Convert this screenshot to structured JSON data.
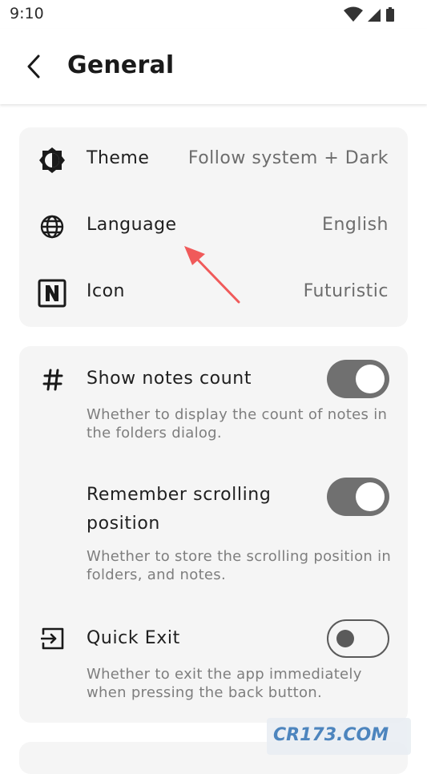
{
  "status": {
    "time": "9:10"
  },
  "header": {
    "title": "General"
  },
  "general_card": {
    "items": [
      {
        "label": "Theme",
        "value": "Follow system + Dark",
        "icon": "theme-icon"
      },
      {
        "label": "Language",
        "value": "English",
        "icon": "globe-icon"
      },
      {
        "label": "Icon",
        "value": "Futuristic",
        "icon": "app-icon-n"
      }
    ]
  },
  "notes_card": {
    "items": [
      {
        "label": "Show notes count",
        "description": "Whether to display the count of notes in the folders dialog.",
        "enabled": true,
        "icon": "hash-icon"
      },
      {
        "label": "Remember scrolling position",
        "description": "Whether to store the scrolling position in folders, and notes.",
        "enabled": true
      },
      {
        "label": "Quick Exit",
        "description": "Whether to exit the app immediately when pressing the back button.",
        "enabled": false,
        "icon": "exit-icon"
      }
    ]
  },
  "watermark": {
    "text": "CR173.COM"
  },
  "colors": {
    "card_bg": "#f5f5f5",
    "toggle_on": "#707070",
    "arrow": "#f05a5a"
  }
}
